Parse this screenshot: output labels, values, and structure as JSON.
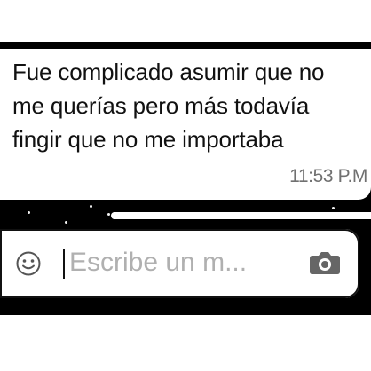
{
  "chat": {
    "messages": [
      {
        "text": "Fue complicado asumir que no me querías pero más todavía fingir que no me importaba",
        "time": "11:53 P.M"
      }
    ]
  },
  "composer": {
    "placeholder": "Escribe un m...",
    "emoji_icon": "emoji-icon",
    "camera_icon": "camera-icon"
  },
  "colors": {
    "background": "#000000",
    "bubble": "#ffffff",
    "text": "#111111",
    "time": "#707070",
    "placeholder": "#b0b0b0"
  }
}
